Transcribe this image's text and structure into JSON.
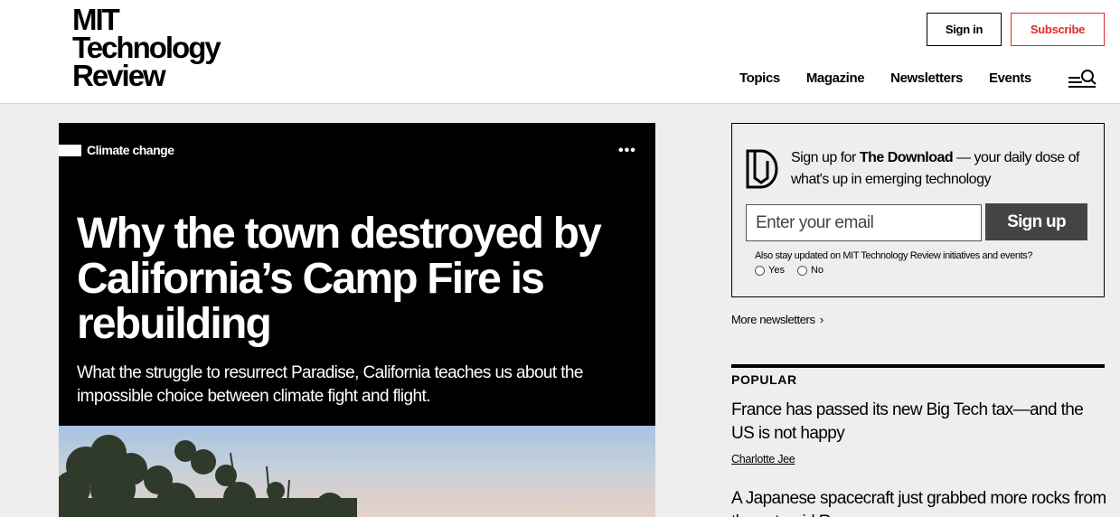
{
  "header": {
    "logo_lines": [
      "MIT",
      "Technology",
      "Review"
    ],
    "sign_in_label": "Sign in",
    "subscribe_label": "Subscribe",
    "nav": [
      "Topics",
      "Magazine",
      "Newsletters",
      "Events"
    ],
    "menu_icon": "menu-search-icon"
  },
  "hero": {
    "tag": "Climate change",
    "more_icon": "more-dots-icon",
    "headline": "Why the town destroyed by California’s Camp Fire is rebuilding",
    "dek": "What the struggle to resurrect Paradise, California teaches us about the impossible choice between climate fight and flight."
  },
  "signup": {
    "icon": "the-download-logo-icon",
    "lead": "Sign up for ",
    "newsletter_name": "The Download",
    "tail": " — your daily dose of what's up in emerging technology",
    "email_placeholder": "Enter your email",
    "button_label": "Sign up",
    "also_stay": "Also stay updated on MIT Technology Review initiatives and events?",
    "yes_label": "Yes",
    "no_label": "No"
  },
  "more_newsletters": "More newsletters",
  "popular": {
    "title": "POPULAR",
    "items": [
      {
        "headline": "France has passed its new Big Tech tax—and the US is not happy",
        "author": "Charlotte Jee"
      },
      {
        "headline": "A Japanese spacecraft just grabbed more rocks from the asteroid Ryugu"
      }
    ]
  },
  "colors": {
    "accent_red": "#e02929",
    "hero_bg": "#000000",
    "page_bg": "#eeeeee",
    "button_dark": "#444444"
  }
}
